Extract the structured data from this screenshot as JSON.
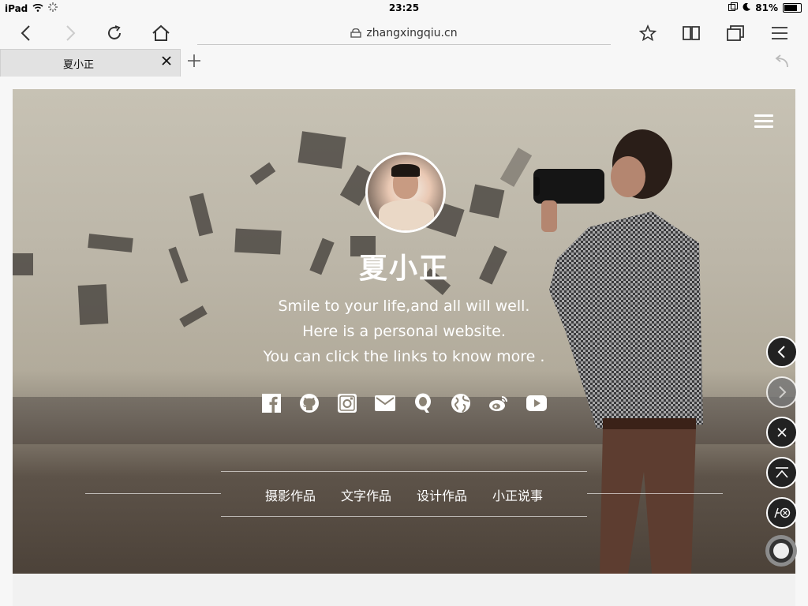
{
  "status_bar": {
    "device": "iPad",
    "time": "23:25",
    "battery": "81%",
    "battery_level": 0.81
  },
  "browser": {
    "address": "zhangxingqiu.cn",
    "tab_title": "夏小正",
    "icons": [
      "back-icon",
      "forward-icon",
      "reload-icon",
      "home-icon",
      "lock-icon",
      "star-icon",
      "book-icon",
      "tabs-icon",
      "menu-icon",
      "close-icon",
      "add-icon",
      "undo-icon"
    ]
  },
  "hero": {
    "name": "夏小正",
    "tagline_lines": [
      "Smile to your life,and all will well.",
      "Here is a personal website.",
      "You can click the links to know more ."
    ],
    "socials": [
      "facebook",
      "github",
      "instagram",
      "email",
      "qq",
      "globe",
      "weibo",
      "youtube"
    ]
  },
  "nav": [
    {
      "label": "摄影作品"
    },
    {
      "label": "文字作品"
    },
    {
      "label": "设计作品"
    },
    {
      "label": "小正说事"
    }
  ],
  "floating_buttons": [
    "back",
    "forward",
    "close",
    "top",
    "clear",
    "home"
  ],
  "colors": {
    "accent": "#ffffff",
    "ui": "#222222"
  }
}
